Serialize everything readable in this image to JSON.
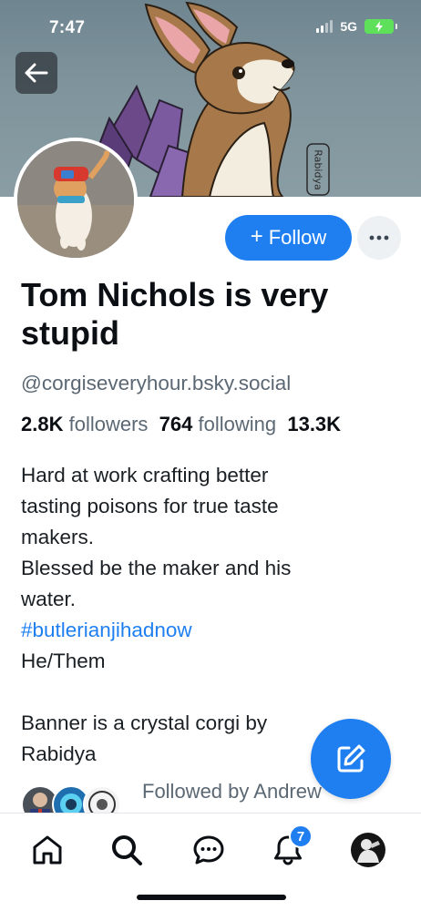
{
  "status_bar": {
    "time": "7:47",
    "network": "5G",
    "icons": [
      "signal-bars-icon",
      "battery-charging-icon"
    ]
  },
  "banner": {
    "signature": "Rabidya"
  },
  "profile": {
    "display_name_line1": "Tom Nichols is very",
    "display_name_line2": "stupid",
    "handle": "@corgiseveryhour.bsky.social",
    "followers_count": "2.8K",
    "followers_label": "followers",
    "following_count": "764",
    "following_label": "following",
    "posts_count": "13.3K"
  },
  "actions": {
    "follow_plus": "+",
    "follow_label": "Follow",
    "more_icon": "ellipsis-icon"
  },
  "bio": {
    "line1": "Hard at work crafting better",
    "line2": "tasting poisons for true taste",
    "line3": "makers.",
    "line4": "Blessed be the maker and his",
    "line5": "water.",
    "hashtag": "#butlerianjihadnow",
    "line7": "He/Them",
    "line9": "Banner is a crystal corgi by",
    "line10": "Rabidya"
  },
  "followed_by": {
    "text": "Followed by Andrew"
  },
  "bottom_nav": {
    "items": [
      "home-icon",
      "search-icon",
      "chat-icon",
      "bell-icon",
      "profile-avatar"
    ],
    "notification_badge": "7"
  },
  "colors": {
    "accent": "#1f7ff0",
    "text": "#0b0f14",
    "muted": "#5b6874"
  }
}
